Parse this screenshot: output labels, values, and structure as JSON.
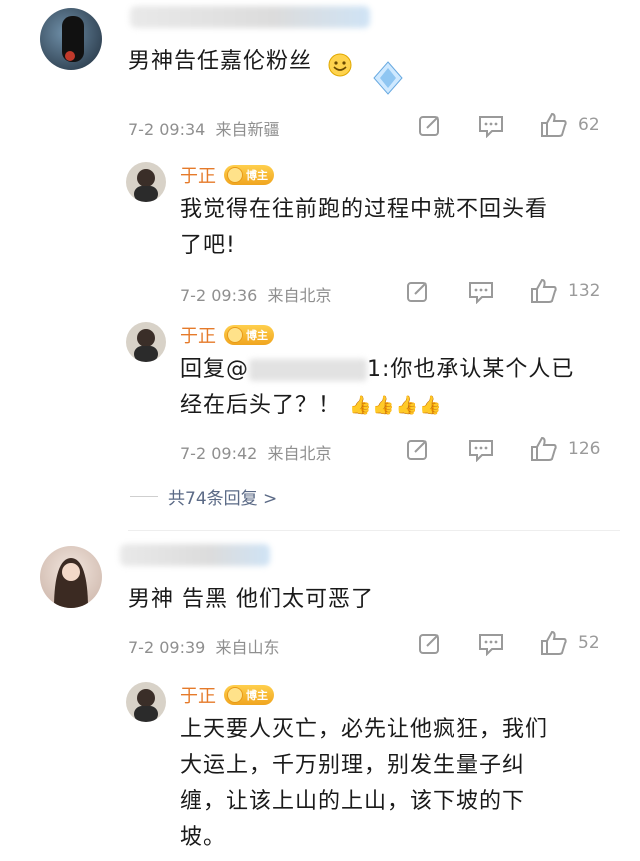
{
  "comments": [
    {
      "text": "男神告任嘉伦粉丝",
      "time": "7-2 09:34",
      "location": "来自新疆",
      "likes": "62",
      "replies": [
        {
          "name": "于正",
          "badge": "博主",
          "text_line1": "我觉得在往前跑的过程中就不回头看",
          "text_line2": "了吧!",
          "time": "7-2 09:36",
          "location": "来自北京",
          "likes": "132"
        },
        {
          "name": "于正",
          "badge": "博主",
          "prefix": "回复@",
          "suffix": "1:你也承认某个人已",
          "text_line2": "经在后头了？！",
          "time": "7-2 09:42",
          "location": "来自北京",
          "likes": "126"
        }
      ],
      "more_replies": "共74条回复 >"
    },
    {
      "text": "男神 告黑 他们太可恶了",
      "time": "7-2 09:39",
      "location": "来自山东",
      "likes": "52",
      "replies": [
        {
          "name": "于正",
          "badge": "博主",
          "line1": "上天要人灭亡，必先让他疯狂，我们",
          "line2": "大运上，千万别理，别发生量子纠",
          "line3": "缠，让该上山的上山，该下坡的下",
          "line4": "坡。"
        }
      ]
    }
  ],
  "icons": [
    "share-icon",
    "comment-icon",
    "like-icon",
    "thumbs-up-emoji",
    "smile-emoji",
    "diamond-emoji"
  ],
  "colors": {
    "accent_name": "#e57a2a",
    "more_link": "#5b6a86",
    "meta": "#8f8f8f"
  }
}
